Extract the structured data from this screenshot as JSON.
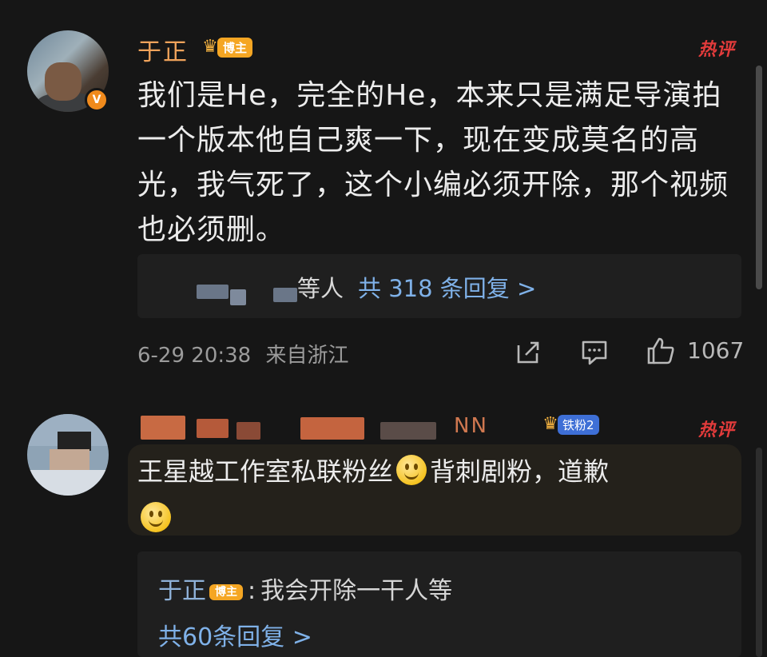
{
  "comments": [
    {
      "author": "于正",
      "author_badge": "博主",
      "hot_label": "热评",
      "text": "我们是He，完全的He，本来只是满足导演拍一个版本他自己爽一下，现在变成莫名的高光，我气死了，这个小编必须开除，那个视频也必须删。",
      "replies_prefix": "等人",
      "replies_link": "共 318 条回复 >",
      "time": "6-29 20:38",
      "location": "来自浙江",
      "like_count": "1067"
    },
    {
      "author_visible_fragment": "NN",
      "author_badge": "铁粉2",
      "hot_label": "热评",
      "text_part1": "王星越工作室私联粉丝",
      "text_part2": "背刺剧粉，道歉",
      "sub_reply": {
        "author": "于正",
        "author_badge": "博主",
        "separator": ":",
        "text": "我会开除一干人等"
      },
      "replies_link": "共60条回复 >"
    }
  ],
  "icons": {
    "share": "share-icon",
    "comment": "comment-icon",
    "like": "like-icon",
    "crown": "crown-icon",
    "smile": "smile-emoji-icon"
  },
  "colors": {
    "background": "#161616",
    "author_name": "#f0a35b",
    "hot_label": "#e23b3b",
    "link": "#7fb1e8",
    "badge": "#f5a623",
    "fan_badge": "#3e6fd6"
  }
}
